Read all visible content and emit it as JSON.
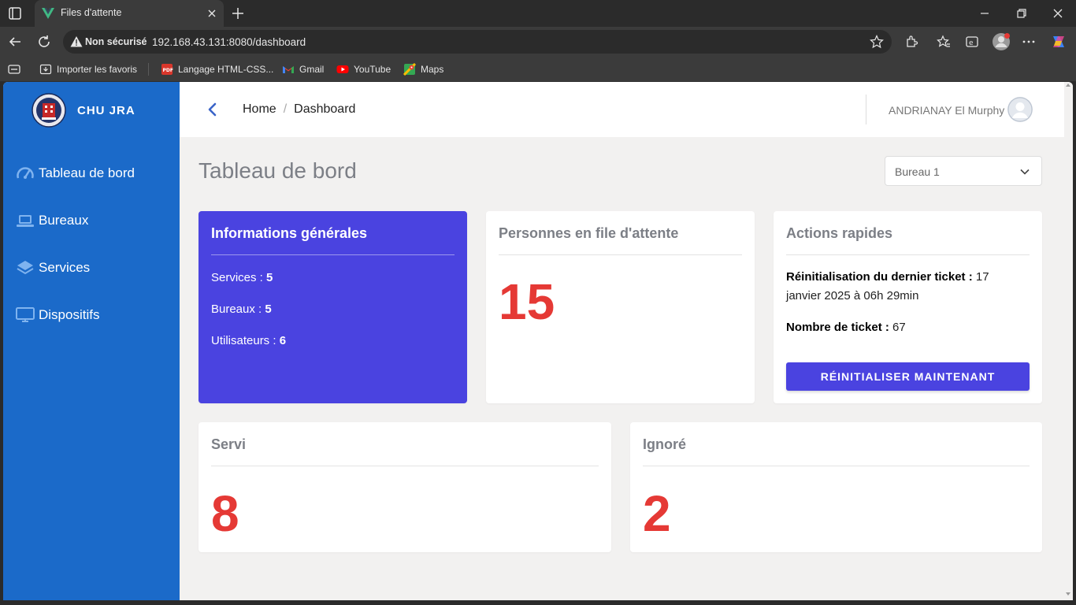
{
  "browser": {
    "tab_title": "Files d'attente",
    "security_label": "Non sécurisé",
    "url": "192.168.43.131:8080/dashboard",
    "bookmarks": [
      {
        "label": "Importer les favoris",
        "icon": "import-icon"
      },
      {
        "label": "Langage HTML-CSS...",
        "icon": "pdf-icon"
      },
      {
        "label": "Gmail",
        "icon": "gmail-icon"
      },
      {
        "label": "YouTube",
        "icon": "youtube-icon"
      },
      {
        "label": "Maps",
        "icon": "maps-icon"
      }
    ]
  },
  "sidebar": {
    "brand": "CHU JRA",
    "items": [
      {
        "label": "Tableau de bord",
        "icon": "gauge-icon"
      },
      {
        "label": "Bureaux",
        "icon": "laptop-icon"
      },
      {
        "label": "Services",
        "icon": "layers-icon"
      },
      {
        "label": "Dispositifs",
        "icon": "monitor-icon"
      }
    ]
  },
  "header": {
    "breadcrumb": [
      "Home",
      "Dashboard"
    ],
    "user_name": "ANDRIANAY El Murphy"
  },
  "main": {
    "title": "Tableau de bord",
    "bureau_select": "Bureau 1",
    "info_card": {
      "title": "Informations générales",
      "services_label": "Services :",
      "services_value": "5",
      "bureaux_label": "Bureaux :",
      "bureaux_value": "5",
      "users_label": "Utilisateurs :",
      "users_value": "6"
    },
    "queue_card": {
      "title": "Personnes en file d'attente",
      "value": "15"
    },
    "actions_card": {
      "title": "Actions rapides",
      "reset_label": "Réinitialisation du dernier ticket :",
      "reset_value": "17 janvier 2025 à 06h 29min",
      "count_label": "Nombre de ticket :",
      "count_value": "67",
      "button": "RÉINITIALISER MAINTENANT"
    },
    "served_card": {
      "title": "Servi",
      "value": "8"
    },
    "ignored_card": {
      "title": "Ignoré",
      "value": "2"
    }
  },
  "colors": {
    "sidebar": "#1b6ac9",
    "accent": "#4a43e0",
    "big_number": "#e53935"
  }
}
